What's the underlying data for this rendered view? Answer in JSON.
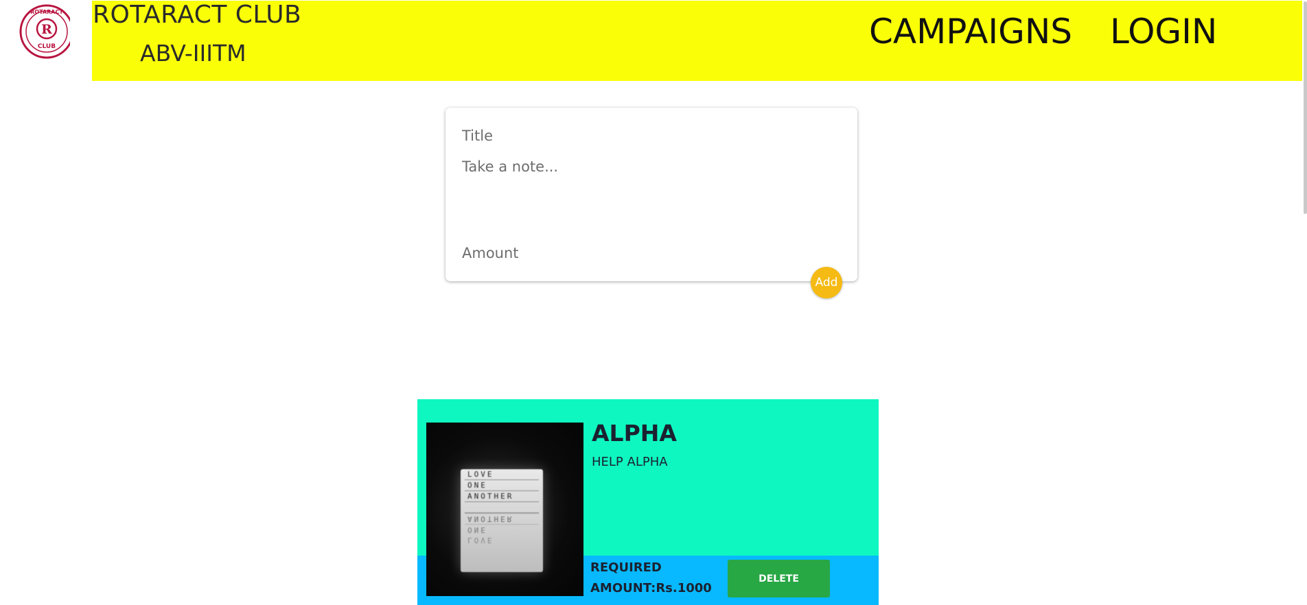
{
  "header": {
    "logo_text_top": "ROTARACT",
    "logo_text_bottom": "CLUB",
    "logo_letter": "R",
    "club_name": "ROTARACT CLUB",
    "club_sub": "ABV-IIITM",
    "nav": {
      "campaigns": "CAMPAIGNS",
      "login": "LOGIN"
    },
    "bg_color": "#faff08"
  },
  "note_form": {
    "title_placeholder": "Title",
    "note_placeholder": "Take a note...",
    "amount_placeholder": "Amount",
    "add_label": "Add",
    "add_color": "#f5ba13"
  },
  "campaign": {
    "title": "ALPHA",
    "description": "HELP ALPHA",
    "amount_line1": "REQUIRED",
    "amount_line2": "AMOUNT:Rs.1000",
    "delete_label": "DELETE",
    "image_text": [
      "LOVE",
      "ONE",
      "ANOTHER",
      "",
      "ANOTHER",
      "ONE",
      "LOVE"
    ],
    "card_color": "#0ef7c1",
    "footer_color": "#08b9ff",
    "delete_color": "#28a745"
  }
}
